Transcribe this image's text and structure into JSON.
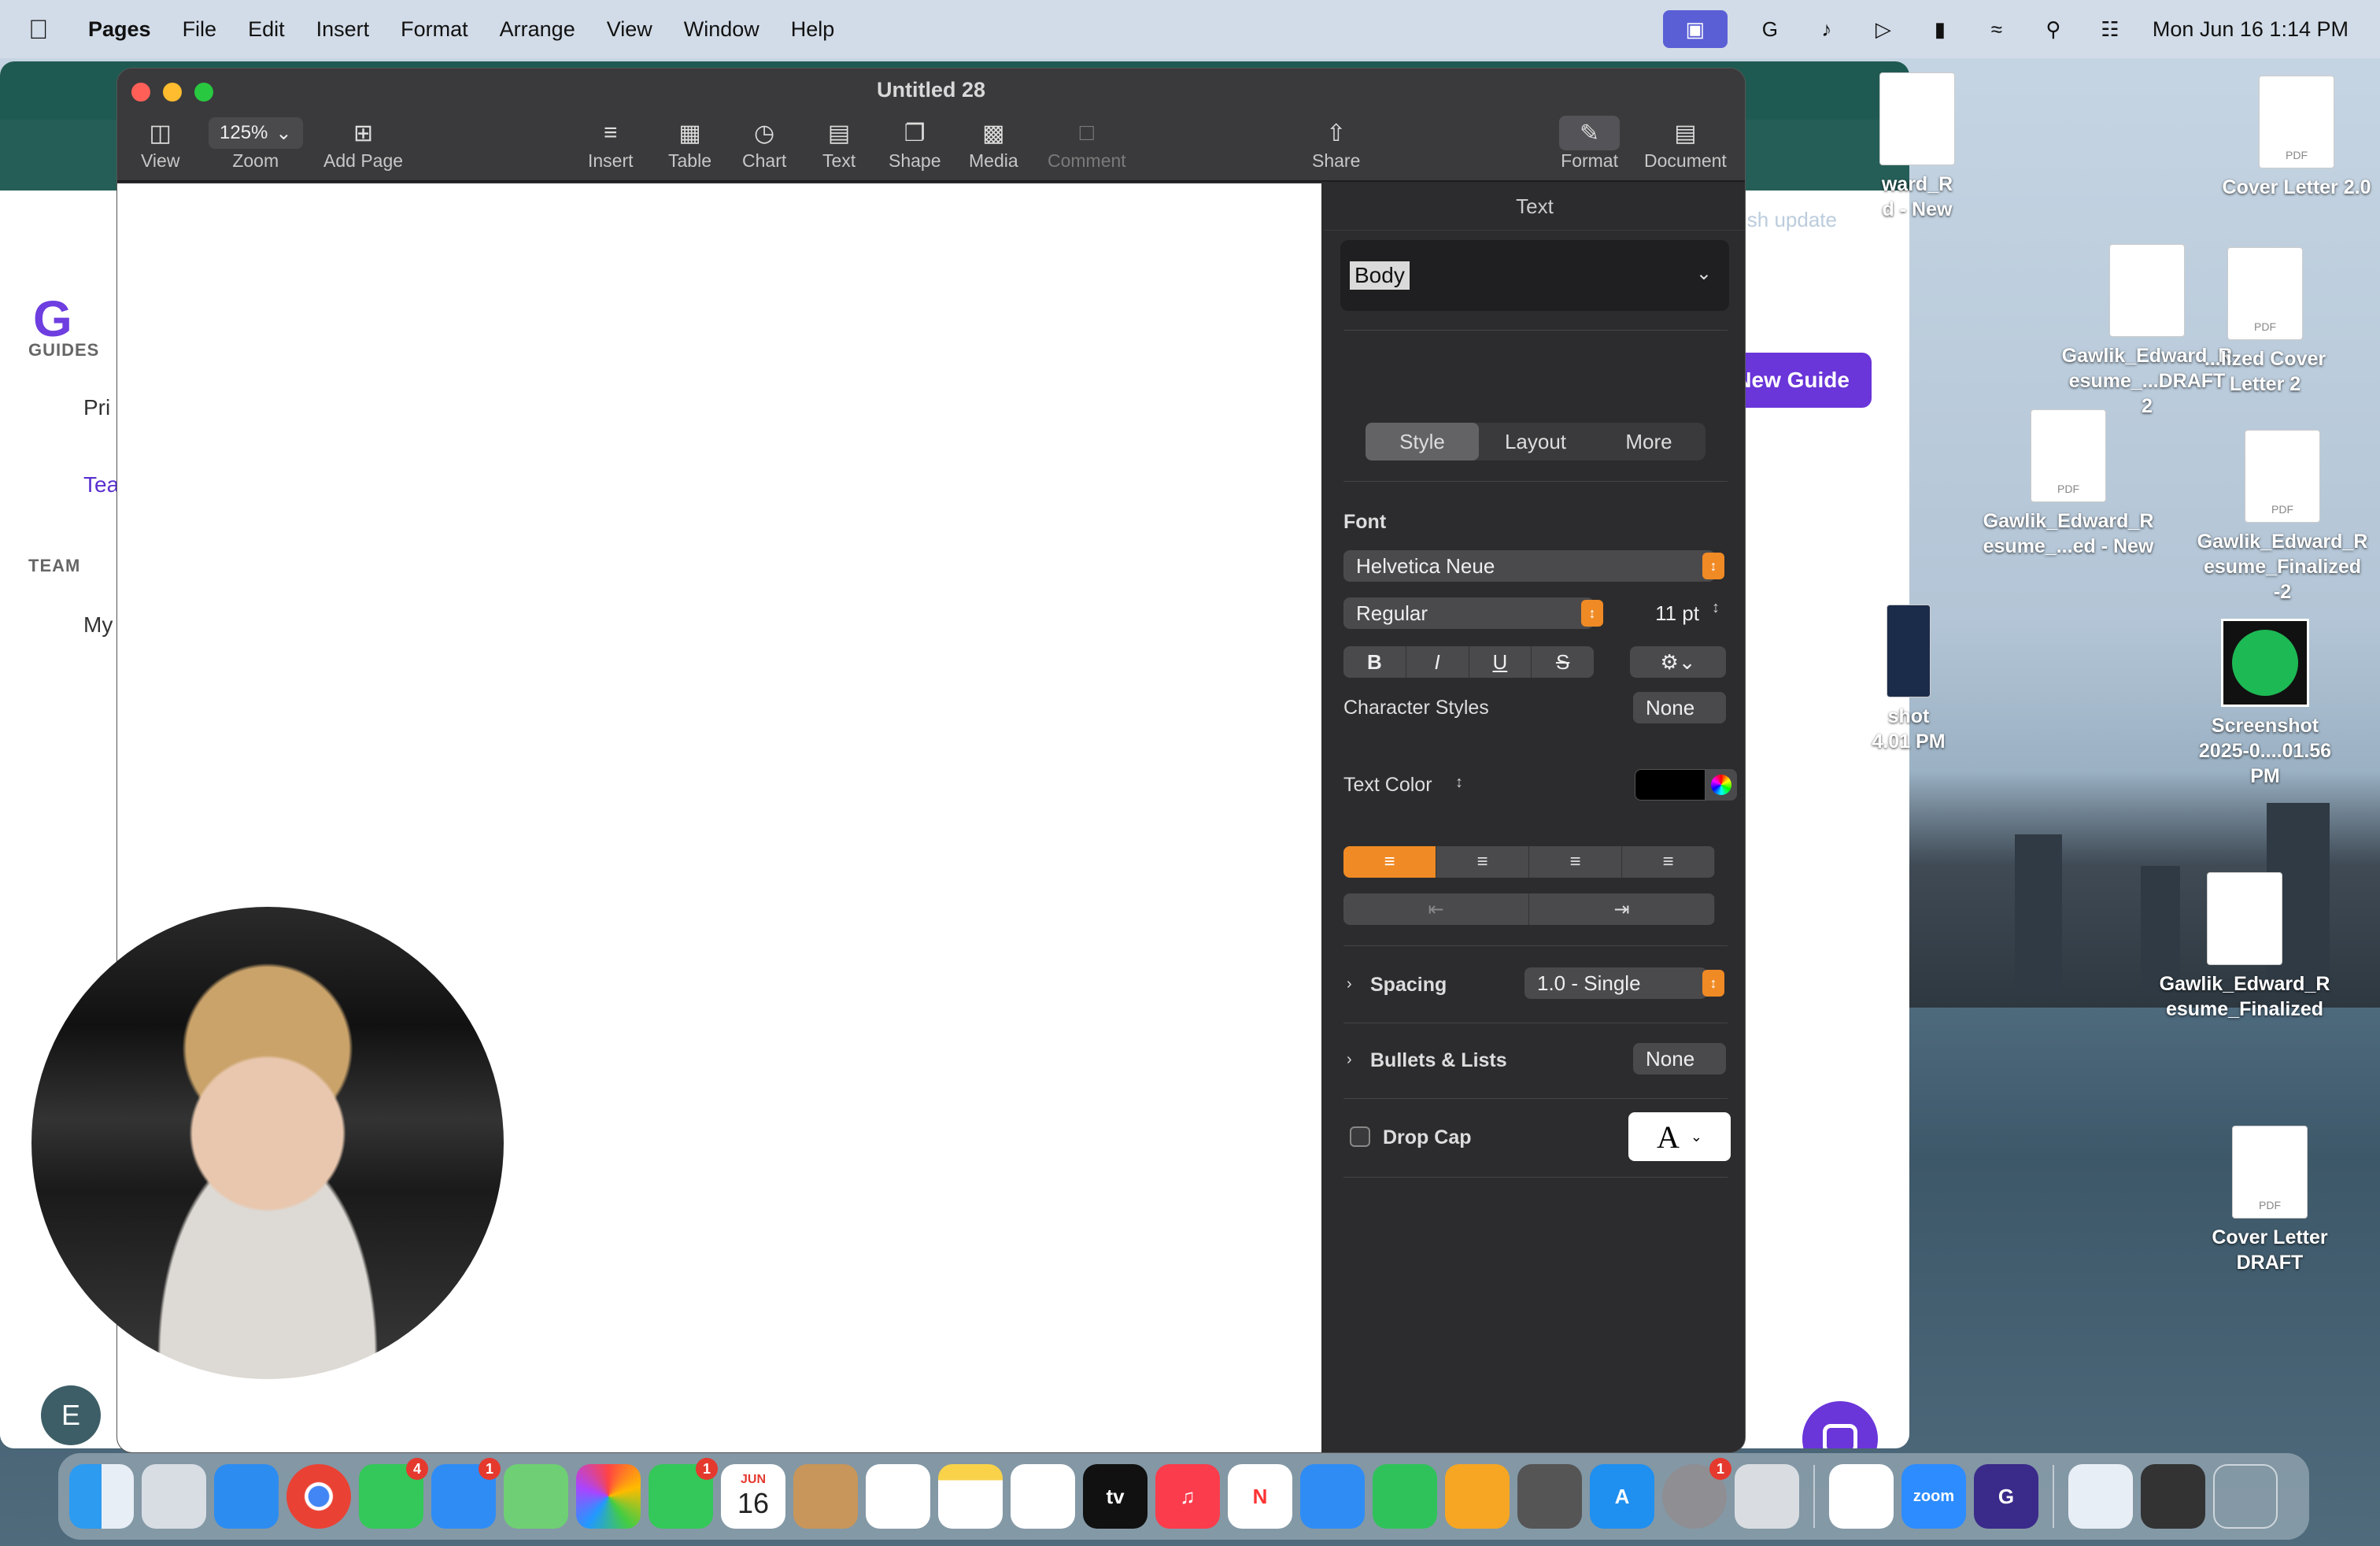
{
  "menubar": {
    "app_name": "Pages",
    "items": [
      "File",
      "Edit",
      "Insert",
      "Format",
      "Arrange",
      "View",
      "Window",
      "Help"
    ],
    "clock": "Mon Jun 16  1:14 PM"
  },
  "background_app": {
    "sidebar": {
      "guides_label": "GUIDES",
      "item1": "Pri",
      "item2": "Tea",
      "team_label": "TEAM",
      "item3": "My"
    },
    "update_text": "ish update",
    "new_guide_button": "New Guide",
    "avatar_initial": "E"
  },
  "pages": {
    "window_title": "Untitled 28",
    "toolbar": {
      "view": "View",
      "zoom_value": "125%",
      "zoom": "Zoom",
      "add_page": "Add Page",
      "insert": "Insert",
      "table": "Table",
      "chart": "Chart",
      "text": "Text",
      "shape": "Shape",
      "media": "Media",
      "comment": "Comment",
      "share": "Share",
      "format": "Format",
      "document": "Document"
    },
    "inspector": {
      "header": "Text",
      "paragraph_style": "Body",
      "tabs": [
        "Style",
        "Layout",
        "More"
      ],
      "font_label": "Font",
      "font_family": "Helvetica Neue",
      "font_weight": "Regular",
      "font_size": "11 pt",
      "bold": "B",
      "italic": "I",
      "underline": "U",
      "strike": "S",
      "character_styles_label": "Character Styles",
      "character_styles_value": "None",
      "text_color_label": "Text Color",
      "text_color": "#000000",
      "spacing_label": "Spacing",
      "spacing_value": "1.0 - Single",
      "bullets_label": "Bullets & Lists",
      "bullets_value": "None",
      "drop_cap_label": "Drop Cap",
      "drop_cap_letter": "A"
    }
  },
  "desktop_icons": [
    {
      "name": "ward_R\nd - New",
      "type": "pdf"
    },
    {
      "name": "Cover Letter 2.0",
      "type": "pdf"
    },
    {
      "name": "Gawlik_Edward_R\nesume_...DRAFT 2",
      "type": "doc"
    },
    {
      "name": "...lized Cover\nLetter 2",
      "type": "pdf"
    },
    {
      "name": "Gawlik_Edward_R\nesume_...ed - New",
      "type": "pdf"
    },
    {
      "name": "Gawlik_Edward_R\nesume_Finalized -2",
      "type": "pdf"
    },
    {
      "name": "shot\n4.01 PM",
      "type": "image"
    },
    {
      "name": "Screenshot\n2025-0....01.56 PM",
      "type": "image"
    },
    {
      "name": "Gawlik_Edward_R\nesume_Finalized",
      "type": "doc"
    },
    {
      "name": "Cover Letter\nDRAFT",
      "type": "pdf"
    }
  ],
  "dock": {
    "badges": {
      "messages": "4",
      "mail": "1",
      "facetime": "1",
      "settings": "1"
    },
    "calendar_month": "JUN",
    "calendar_day": "16"
  },
  "colors": {
    "accent_orange": "#f08a24",
    "guidde_purple": "#6a35d9"
  }
}
